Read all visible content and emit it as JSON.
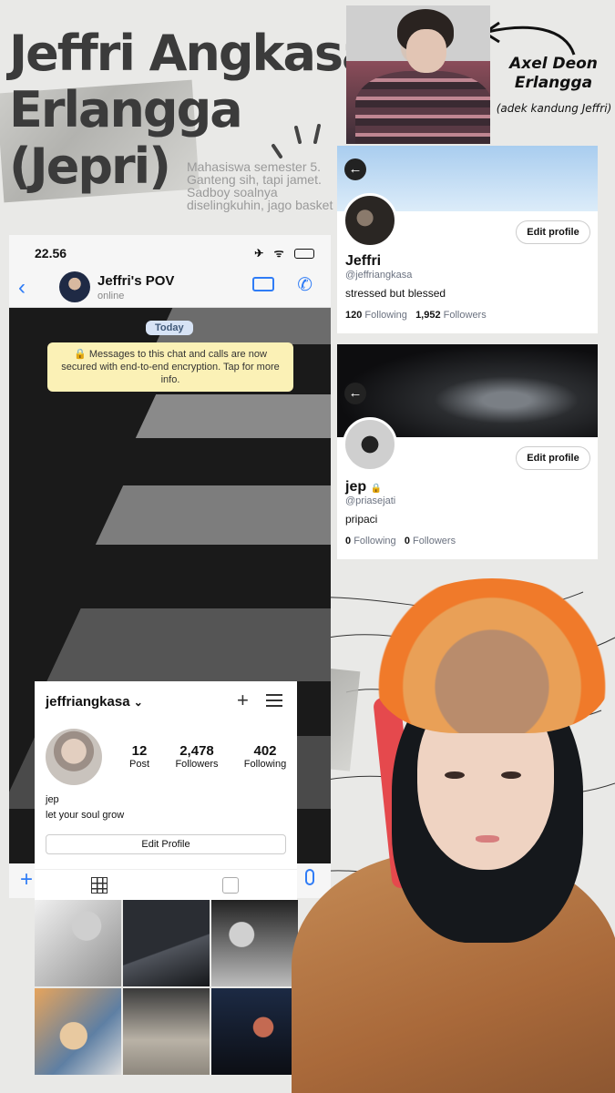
{
  "poster": {
    "title_line1": "Jeffri Angkasa",
    "title_line2": "Erlangga",
    "title_line3": "(Jepri)",
    "description": "Mahasiswa semester 5. Ganteng sih, tapi jamet. Sadboy soalnya diselingkuhin, jago basket",
    "sibling_name_line1": "Axel Deon",
    "sibling_name_line2": "Erlangga",
    "sibling_note": "(adek kandung Jeffri)"
  },
  "twitter_main": {
    "back_icon": "←",
    "edit_label": "Edit profile",
    "name": "Jeffri",
    "handle": "@jeffriangkasa",
    "bio": "stressed but blessed",
    "following_count": "120",
    "following_label": "Following",
    "followers_count": "1,952",
    "followers_label": "Followers",
    "banner_color": "#bcd9f3"
  },
  "twitter_alt": {
    "back_icon": "←",
    "edit_label": "Edit profile",
    "name": "jep",
    "lock_icon": "🔒",
    "handle": "@priasejati",
    "bio": "pripaci",
    "following_count": "0",
    "following_label": "Following",
    "followers_count": "0",
    "followers_label": "Followers"
  },
  "whatsapp": {
    "status_time": "22.56",
    "status_icons": "✈ ᯤ",
    "back_icon": "‹",
    "chat_name": "Jeffri's POV",
    "chat_status": "online",
    "call_icon": "✆",
    "date_chip": "Today",
    "encryption_notice": "🔒 Messages to this chat and calls are now secured with end-to-end encryption. Tap for more info.",
    "plus_icon": "+",
    "accent": "#2f7cf6"
  },
  "instagram": {
    "username": "jeffriangkasa",
    "dropdown_icon": "⌄",
    "new_post_icon": "+",
    "posts_count": "12",
    "posts_label": "Post",
    "followers_count": "2,478",
    "followers_label": "Followers",
    "following_count": "402",
    "following_label": "Following",
    "bio_name": "jep",
    "bio_text": "let your soul grow",
    "edit_label": "Edit Profile"
  }
}
